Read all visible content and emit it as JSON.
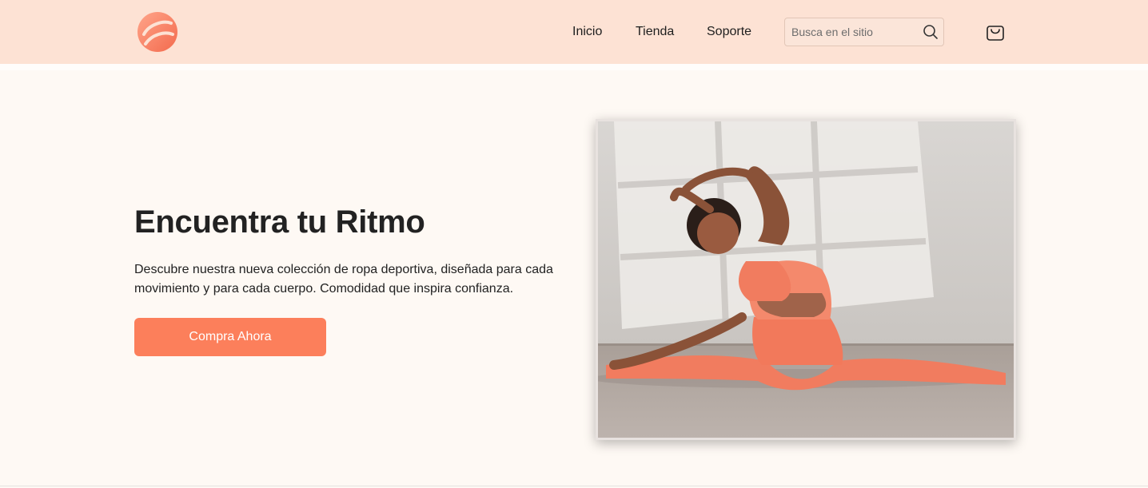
{
  "nav": {
    "links": [
      {
        "label": "Inicio"
      },
      {
        "label": "Tienda"
      },
      {
        "label": "Soporte"
      }
    ],
    "search": {
      "placeholder": "Busca en el sitio",
      "value": ""
    },
    "icons": {
      "logo": "brand-logo",
      "search": "search-icon",
      "cart": "shopping-bag-icon"
    }
  },
  "hero": {
    "title": "Encuentra tu Ritmo",
    "description": "Descubre nuestra nueva colección de ropa deportiva, diseñada para cada movimiento y para cada cuerpo. Comodidad que inspira confianza.",
    "cta_label": "Compra Ahora"
  },
  "colors": {
    "header_bg": "#fde2d4",
    "page_bg": "#fef9f4",
    "accent": "#fc7f5b",
    "text": "#222222"
  }
}
